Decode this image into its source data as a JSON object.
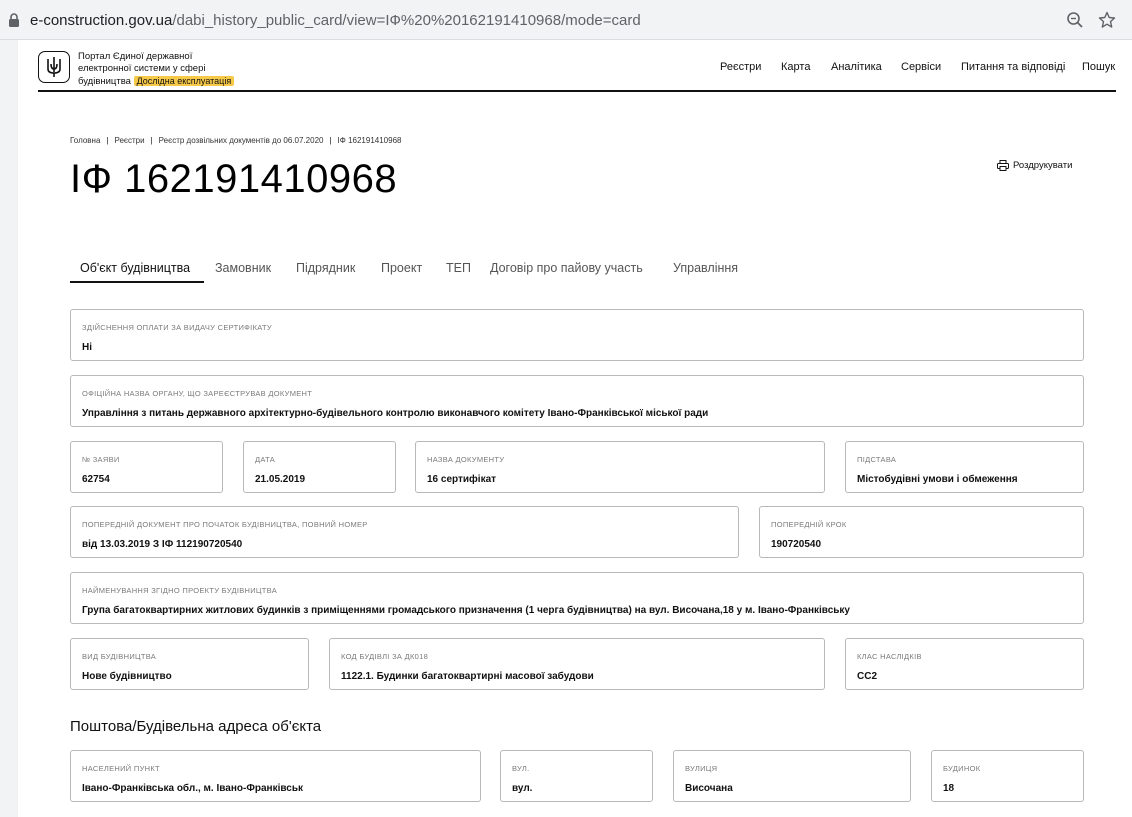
{
  "browser": {
    "url_host": "e-construction.gov.ua",
    "url_path": "/dabi_history_public_card/view=IФ%20%20162191410968/mode=card"
  },
  "header": {
    "portal_line1": "Портал Єдиної державної",
    "portal_line2": "електронної системи у сфері",
    "portal_line3": "будівництва",
    "badge": "Дослідна експлуатація",
    "nav": [
      "Реєстри",
      "Карта",
      "Аналітика",
      "Сервіси",
      "Питання та відповіді",
      "Пошук"
    ]
  },
  "breadcrumb": [
    "Головна",
    "Реєстри",
    "Реєстр дозвільних документів до 06.07.2020",
    "ІФ 162191410968"
  ],
  "page_title": "ІФ 162191410968",
  "print_label": "Роздрукувати",
  "tabs": [
    "Об'єкт будівництва",
    "Замовник",
    "Підрядник",
    "Проект",
    "ТЕП",
    "Договір про пайову участь",
    "Управління"
  ],
  "fields": {
    "payment": {
      "label": "Здійснення оплати за видачу сертифікату",
      "value": "Ні"
    },
    "authority": {
      "label": "Офіційна назва органу, що зареєстрував документ",
      "value": "Управління з питань державного архітектурно-будівельного контролю виконавчого комітету Івано-Франківської міської ради"
    },
    "app_no": {
      "label": "№ заяви",
      "value": "62754"
    },
    "date": {
      "label": "Дата",
      "value": "21.05.2019"
    },
    "doc_name": {
      "label": "Назва документу",
      "value": "16 сертифікат"
    },
    "basis": {
      "label": "Підстава",
      "value": "Містобудівні умови і обмеження"
    },
    "prev_doc": {
      "label": "Попередній документ про початок будівництва, повний номер",
      "value": "від 13.03.2019 З ІФ 112190720540"
    },
    "prev_step": {
      "label": "Попередній крок",
      "value": "190720540"
    },
    "project_name": {
      "label": "Найменування згідно проекту будівництва",
      "value": "Група багатоквартирних житлових будинків з приміщеннями громадського призначення (1 черга будівництва) на вул. Височана,18 у м. Івано-Франківську"
    },
    "build_type": {
      "label": "Вид будівництва",
      "value": "Нове будівництво"
    },
    "building_code": {
      "label": "Код будівлі за ДК018",
      "value": "1122.1. Будинки багатоквартирні масової забудови"
    },
    "consequence": {
      "label": "Клас наслідків",
      "value": "СС2"
    }
  },
  "address_section_title": "Поштова/Будівельна адреса об'єкта",
  "address": {
    "locality": {
      "label": "Населений пункт",
      "value": "Івано-Франківська обл., м. Івано-Франківськ"
    },
    "street_type": {
      "label": "Вул.",
      "value": "вул."
    },
    "street": {
      "label": "Вулиця",
      "value": "Височана"
    },
    "house": {
      "label": "Будинок",
      "value": "18"
    }
  }
}
